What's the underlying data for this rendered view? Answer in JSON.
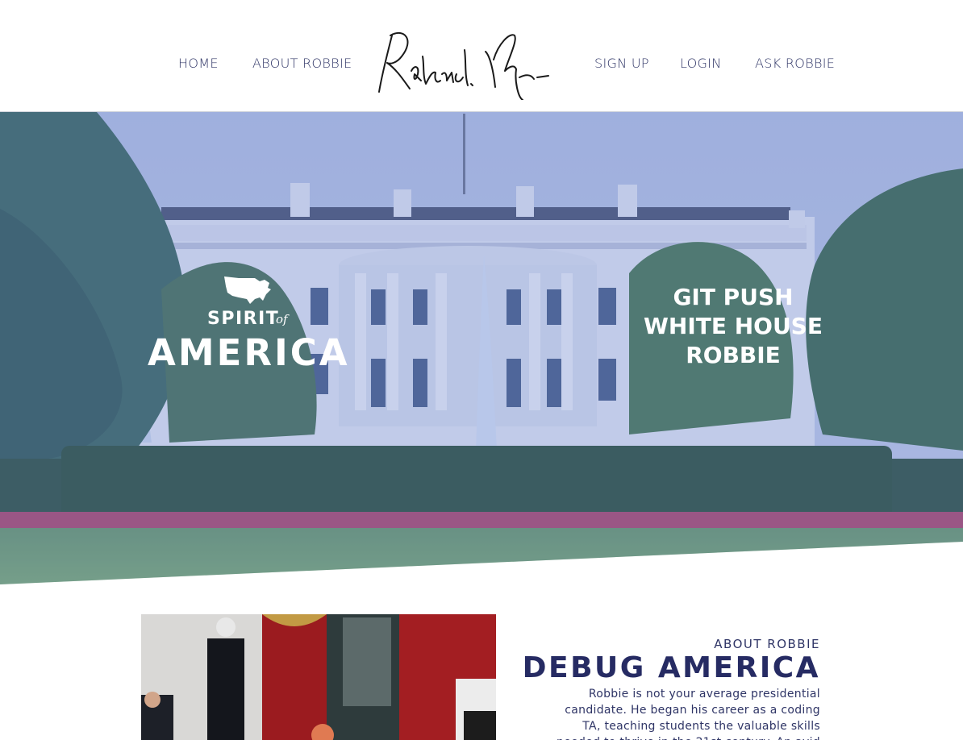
{
  "nav": {
    "home": "HOME",
    "about": "ABOUT ROBBIE",
    "signup": "SIGN UP",
    "login": "LOGIN",
    "ask": "ASK ROBBIE"
  },
  "hero": {
    "logo_spirit": "SPIRIT",
    "logo_of": "of",
    "logo_america": "AMERICA",
    "slogan_line1": "GIT PUSH",
    "slogan_line2": "WHITE HOUSE",
    "slogan_line3": "ROBBIE"
  },
  "about": {
    "kicker": "ABOUT ROBBIE",
    "title": "DEBUG AMERICA",
    "body": "Robbie is not your average presidential candidate. He began his career as a coding TA, teaching students the valuable skills needed to thrive in the 21st century. An avid football"
  },
  "colors": {
    "accent_navy": "#262b63",
    "nav_text": "#2f3566",
    "hero_tint": "#5f78c8"
  }
}
